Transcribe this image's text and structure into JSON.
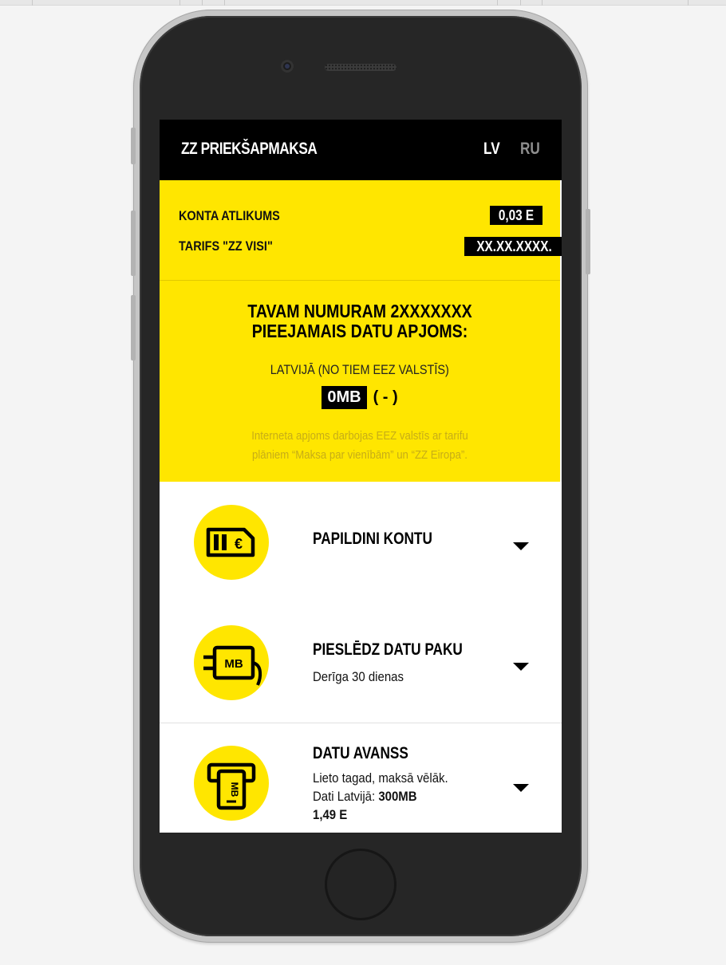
{
  "header": {
    "title": "ZZ PRIEKŠAPMAKSA",
    "lang_lv": "LV",
    "lang_ru": "RU"
  },
  "account": {
    "balance_label": "KONTA ATLIKUMS",
    "balance_value": "0,03 E",
    "tariff_label": "TARIFS \"ZZ VISI\"",
    "tariff_value": "XX.XX.XXXX."
  },
  "data_info": {
    "headline_line1": "TAVAM NUMURAM 2XXXXXXX",
    "headline_line2": "PIEEJAMAIS DATU APJOMS:",
    "sub": "LATVIJĀ (NO TIEM EEZ VALSTĪS)",
    "amount": "0MB",
    "paren": "( - )",
    "note_line1": "Interneta apjoms darbojas EEZ valstīs ar tarifu",
    "note_line2": "plāniem “Maksa par vienībām” un “ZZ Eiropa”."
  },
  "items": [
    {
      "title": "PAPILDINI KONTU",
      "icon": "sim-card-euro-icon"
    },
    {
      "title": "PIESLĒDZ DATU PAKU",
      "line1": "Derīga 30 dienas",
      "icon": "data-plug-icon"
    },
    {
      "title": "DATU AVANSS",
      "line1": "Lieto tagad, maksā vēlāk.",
      "line2_prefix": "Dati Latvijā: ",
      "line2_value": "300MB",
      "price": "1,49 E",
      "icon": "atm-data-icon"
    }
  ],
  "colors": {
    "brand_yellow": "#ffe600",
    "header_black": "#000000",
    "lang_inactive": "#8e8e8e"
  }
}
